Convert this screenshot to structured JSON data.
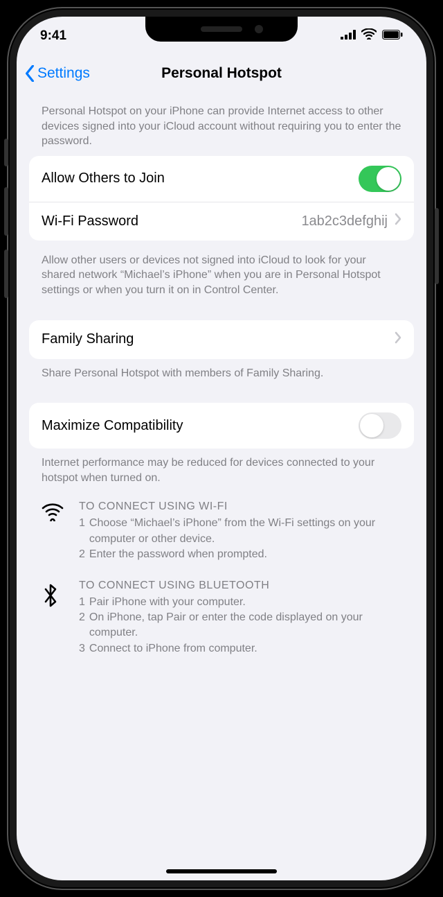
{
  "statusbar": {
    "time": "9:41"
  },
  "nav": {
    "back": "Settings",
    "title": "Personal Hotspot"
  },
  "intro": "Personal Hotspot on your iPhone can provide Internet access to other devices signed into your iCloud account without requiring you to enter the password.",
  "rows": {
    "allowOthers": {
      "label": "Allow Others to Join",
      "on": true
    },
    "wifiPassword": {
      "label": "Wi-Fi Password",
      "value": "1ab2c3defghij"
    },
    "familySharing": {
      "label": "Family Sharing"
    },
    "maxCompat": {
      "label": "Maximize Compatibility",
      "on": false
    }
  },
  "footers": {
    "allow": "Allow other users or devices not signed into iCloud to look for your shared network “Michael’s iPhone” when you are in Personal Hotspot settings or when you turn it on in Control Center.",
    "family": "Share Personal Hotspot with members of Family Sharing.",
    "compat": "Internet performance may be reduced for devices connected to your hotspot when turned on."
  },
  "instructions": {
    "wifi": {
      "title": "TO CONNECT USING WI-FI",
      "steps": [
        "Choose “Michael’s iPhone” from the Wi-Fi settings on your computer or other device.",
        "Enter the password when prompted."
      ]
    },
    "bt": {
      "title": "TO CONNECT USING BLUETOOTH",
      "steps": [
        "Pair iPhone with your computer.",
        "On iPhone, tap Pair or enter the code displayed on your computer.",
        "Connect to iPhone from computer."
      ]
    }
  }
}
